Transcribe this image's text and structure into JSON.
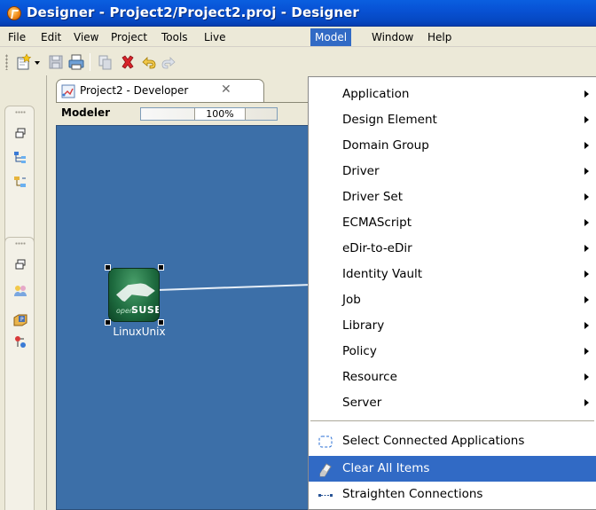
{
  "window": {
    "title": "Designer - Project2/Project2.proj - Designer"
  },
  "menubar": {
    "items": [
      "File",
      "Edit",
      "View",
      "Project",
      "Tools",
      "Live",
      "Model",
      "Window",
      "Help"
    ]
  },
  "editor": {
    "tab_label": "Project2 - Developer",
    "modeler_label": "Modeler",
    "zoom": "100%",
    "node_label": "LinuxUnix"
  },
  "model_menu": {
    "submenus": [
      "Application",
      "Design Element",
      "Domain Group",
      "Driver",
      "Driver Set",
      "ECMAScript",
      "eDir-to-eDir",
      "Identity Vault",
      "Job",
      "Library",
      "Policy",
      "Resource",
      "Server"
    ],
    "actions": [
      "Select Connected Applications",
      "Clear All Items",
      "Straighten Connections"
    ],
    "highlighted": "Clear All Items"
  },
  "colors": {
    "titlebar": "#0853d6",
    "highlight": "#316ac5",
    "canvas": "#3c6fa8"
  }
}
